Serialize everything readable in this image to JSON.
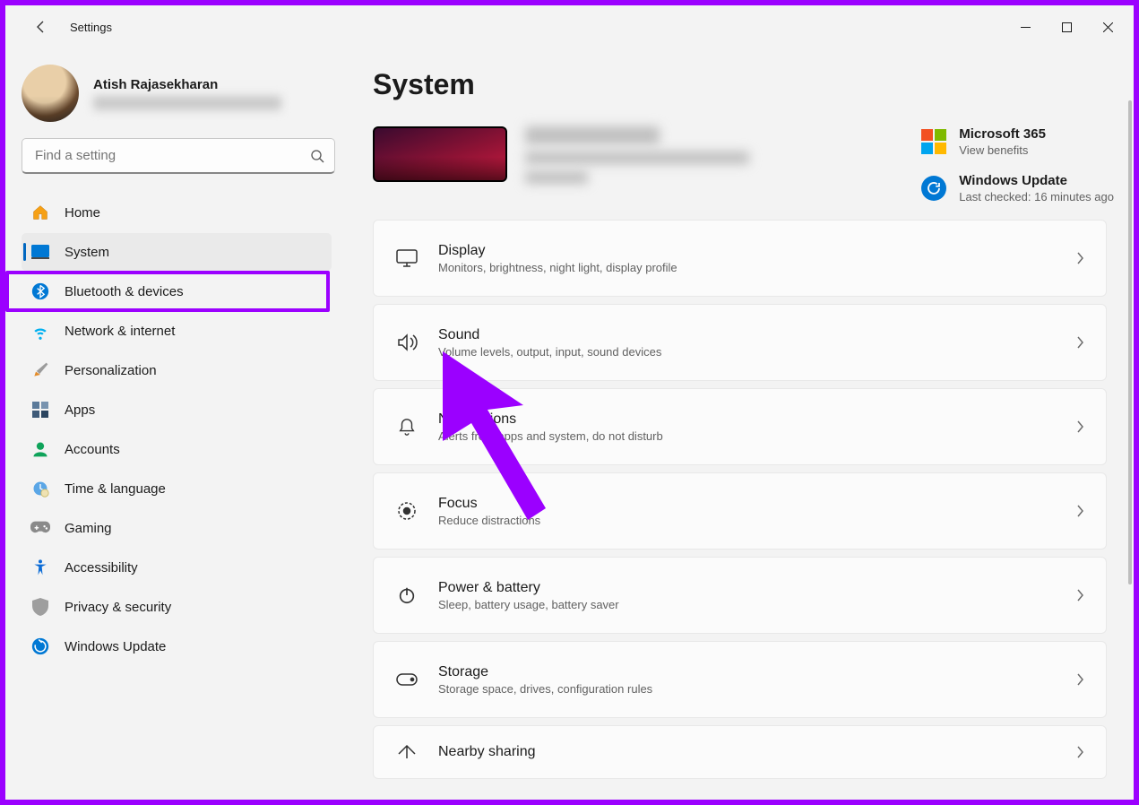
{
  "app": {
    "title": "Settings"
  },
  "profile": {
    "name": "Atish Rajasekharan"
  },
  "search": {
    "placeholder": "Find a setting"
  },
  "sidebar": {
    "items": [
      {
        "label": "Home"
      },
      {
        "label": "System"
      },
      {
        "label": "Bluetooth & devices"
      },
      {
        "label": "Network & internet"
      },
      {
        "label": "Personalization"
      },
      {
        "label": "Apps"
      },
      {
        "label": "Accounts"
      },
      {
        "label": "Time & language"
      },
      {
        "label": "Gaming"
      },
      {
        "label": "Accessibility"
      },
      {
        "label": "Privacy & security"
      },
      {
        "label": "Windows Update"
      }
    ],
    "active_index": 1
  },
  "page": {
    "title": "System"
  },
  "right_cards": {
    "ms365": {
      "title": "Microsoft 365",
      "subtitle": "View benefits"
    },
    "update": {
      "title": "Windows Update",
      "subtitle": "Last checked: 16 minutes ago"
    }
  },
  "settings": [
    {
      "title": "Display",
      "subtitle": "Monitors, brightness, night light, display profile"
    },
    {
      "title": "Sound",
      "subtitle": "Volume levels, output, input, sound devices"
    },
    {
      "title": "Notifications",
      "subtitle": "Alerts from apps and system, do not disturb"
    },
    {
      "title": "Focus",
      "subtitle": "Reduce distractions"
    },
    {
      "title": "Power & battery",
      "subtitle": "Sleep, battery usage, battery saver"
    },
    {
      "title": "Storage",
      "subtitle": "Storage space, drives, configuration rules"
    },
    {
      "title": "Nearby sharing",
      "subtitle": ""
    }
  ]
}
